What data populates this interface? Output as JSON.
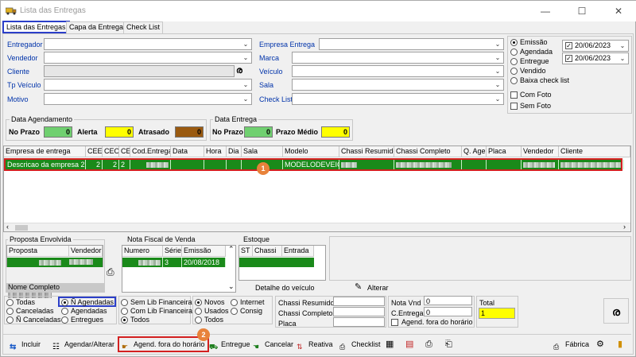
{
  "window": {
    "title": "Lista das Entregas",
    "minimize": "—",
    "maximize": "☐",
    "close": "✕"
  },
  "tabs": [
    "Lista das Entregas",
    "Capa da Entrega",
    "Check List"
  ],
  "filters_left": {
    "entregador": "Entregador",
    "vendedor": "Vendedor",
    "cliente": "Cliente",
    "tp_veiculo": "Tp Veículo",
    "motivo": "Motivo"
  },
  "filters_mid": {
    "empresa": "Empresa Entrega",
    "marca": "Marca",
    "veiculo": "Veículo",
    "sala": "Sala",
    "check_list": "Check List"
  },
  "date_options": {
    "emissao": "Emissão",
    "agendada": "Agendada",
    "entregue": "Entregue",
    "vendido": "Vendido",
    "baixa": "Baixa check list",
    "date1": "20/06/2023",
    "date2": "20/06/2023",
    "com_foto": "Com Foto",
    "sem_foto": "Sem Foto"
  },
  "agendamento": {
    "title": "Data Agendamento",
    "no_prazo": "No Prazo",
    "no_prazo_val": "0",
    "alerta": "Alerta",
    "alerta_val": "0",
    "atrasado": "Atrasado",
    "atrasado_val": "0"
  },
  "entrega": {
    "title": "Data Entrega",
    "no_prazo": "No Prazo",
    "no_prazo_val": "0",
    "prazo_medio": "Prazo Médio",
    "prazo_medio_val": "0"
  },
  "main_grid": {
    "headers": [
      "Empresa de entrega",
      "CEE",
      "CEO",
      "CE",
      "Cod.Entrega",
      "Data",
      "Hora",
      "Dia",
      "Sala",
      "Modelo",
      "Chassi Resumido",
      "Chassi Completo",
      "Q. Age",
      "Placa",
      "Vendedor",
      "Cliente"
    ],
    "row": {
      "empresa": "Descricao da empresa 2",
      "cee": "2",
      "ceo": "2",
      "ce": "2",
      "modelo": "MODELODEVEIC"
    },
    "badge": "1"
  },
  "proposta": {
    "title": "Proposta Envolvida",
    "h1": "Proposta",
    "h2": "Vendedor",
    "nome": "Nome Completo"
  },
  "nota": {
    "title": "Nota Fiscal de Venda",
    "h1": "Numero",
    "h2": "Série",
    "h3": "Emissão",
    "serie": "3",
    "emissao": "20/08/2018"
  },
  "estoque": {
    "title": "Estoque",
    "h1": "ST",
    "h2": "Chassi",
    "h3": "Entrada",
    "detalhe": "Detalhe do veículo"
  },
  "alterar": "Alterar",
  "status_radios": {
    "todas": "Todas",
    "agendadas_n": "Ñ Agendadas",
    "canceladas": "Canceladas",
    "agendadas": "Agendadas",
    "canceladas_n": "Ñ Canceladas",
    "entregues": "Entregues"
  },
  "lib_radios": {
    "sem": "Sem Lib Financeira",
    "com": "Com Lib Financeira",
    "todos": "Todos"
  },
  "novos_radios": {
    "novos": "Novos",
    "internet": "Internet",
    "usados": "Usados",
    "consig": "Consig",
    "todos": "Todos"
  },
  "chassi": {
    "resumido": "Chassi Resumido",
    "completo": "Chassi Completo",
    "placa": "Placa"
  },
  "nota_vnd": {
    "label": "Nota Vnd",
    "val": "0",
    "centrega": "C.Entrega",
    "centrega_val": "0",
    "agend_fora": "Agend. fora do horário"
  },
  "total": {
    "label": "Total",
    "val": "1"
  },
  "toolbar": {
    "incluir": "Incluir",
    "agendar": "Agendar/Alterar",
    "agend_fora": "Agend. fora do horário",
    "badge": "2",
    "entregue": "Entregue",
    "cancelar": "Cancelar",
    "reativa": "Reativa",
    "checklist": "Checklist",
    "fabrica": "Fábrica"
  }
}
